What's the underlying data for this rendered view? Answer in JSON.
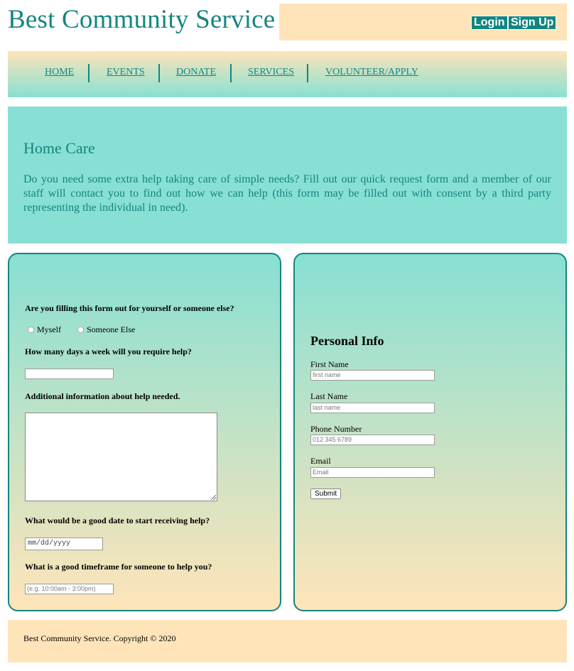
{
  "site": {
    "title": "Best Community Service"
  },
  "auth": {
    "login_label": "Login",
    "signup_label": "Sign Up"
  },
  "nav": {
    "items": [
      {
        "label": "HOME"
      },
      {
        "label": "EVENTS"
      },
      {
        "label": "DONATE"
      },
      {
        "label": "SERVICES"
      },
      {
        "label": "VOLUNTEER/APPLY"
      }
    ]
  },
  "hero": {
    "title": "Home Care",
    "text": "Do you need some extra help taking care of simple needs? Fill out our quick request form and a member of our staff will contact you to find out how we can help (this form may be filled out with consent by a third party representing the individual in need)."
  },
  "request_form": {
    "q_who": "Are you filling this form out for yourself or someone else?",
    "option_myself": "Myself",
    "option_someone_else": "Someone Else",
    "q_days": "How many days a week will you require help?",
    "days_value": "",
    "q_additional": "Additional information about help needed.",
    "additional_value": "",
    "q_start_date": "What would be a good date to start receiving help?",
    "start_date_placeholder": "mm/dd/yyyy",
    "q_timeframe": "What is a good timeframe for someone to help you?",
    "timeframe_placeholder": "(e.g. 10:00am - 3:00pm)"
  },
  "personal_info": {
    "title": "Personal Info",
    "first_name_label": "First Name",
    "first_name_placeholder": "first name",
    "last_name_label": "Last Name",
    "last_name_placeholder": "last name",
    "phone_label": "Phone Number",
    "phone_placeholder": "012 345 6789",
    "email_label": "Email",
    "email_placeholder": "Email",
    "submit_label": "Submit"
  },
  "footer": {
    "text": "Best Community Service. Copyright © 2020"
  },
  "colors": {
    "teal": "#15857f",
    "mint": "#87e0d3",
    "peach": "#ffe4b9"
  }
}
